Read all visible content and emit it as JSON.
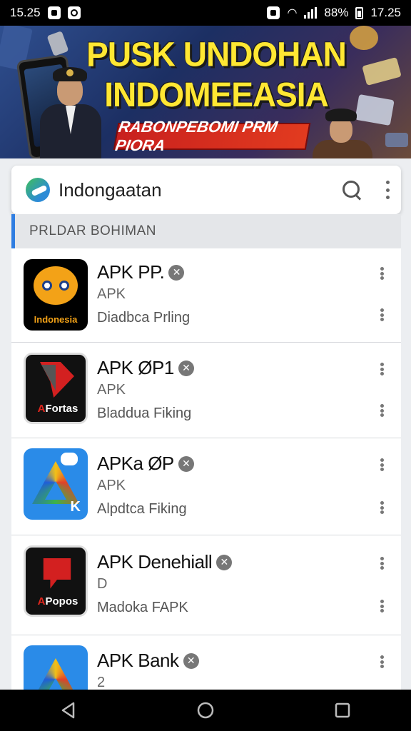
{
  "status_bar": {
    "time_left": "15.25",
    "battery_pct": "88%",
    "time_right": "17.25"
  },
  "banner": {
    "title": "PUSK UNDOHAN INDOMEEASIA",
    "ribbon": "RABONPEBOMI PRM PIORA"
  },
  "search_bar": {
    "title": "Indongaatan"
  },
  "section": {
    "header": "PRLDAR BOHIMAN"
  },
  "apps": [
    {
      "name": "APK PP.",
      "sub": "APK",
      "desc": "Diadbca Prling",
      "icon_caption": "Indonesia",
      "icon_style": "yellow"
    },
    {
      "name": "APK ØP1",
      "sub": "APK",
      "desc": "Bladdua Fiking",
      "icon_caption": "Fortas",
      "icon_style": "red"
    },
    {
      "name": "APKa ØP",
      "sub": "APK",
      "desc": "Alpdtca Fiking",
      "icon_caption": "K",
      "icon_style": "blue"
    },
    {
      "name": "APK Denehiall",
      "sub": "D",
      "desc": "Madoka FAPK",
      "icon_caption": "Popos",
      "icon_style": "red"
    },
    {
      "name": "APK Bank",
      "sub": "2",
      "desc": "",
      "icon_caption": "",
      "icon_style": "blue"
    }
  ],
  "colors": {
    "accent": "#2f7de1",
    "banner_title": "#ffe733",
    "ribbon": "#d12a1e"
  }
}
